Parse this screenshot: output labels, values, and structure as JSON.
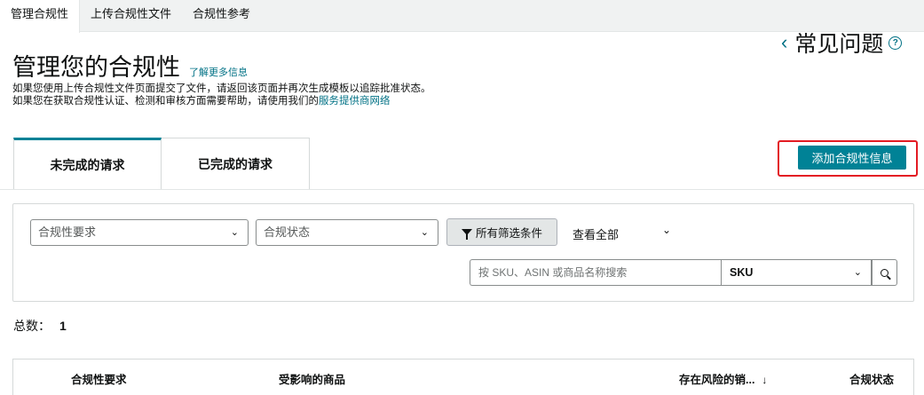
{
  "top_tabs": [
    "管理合规性",
    "上传合规性文件",
    "合规性参考"
  ],
  "header": {
    "title": "管理您的合规性",
    "learn_more": "了解更多信息",
    "desc_line1": "如果您使用上传合规性文件页面提交了文件，请返回该页面并再次生成模板以追踪批准状态。",
    "desc_line2_prefix": "如果您在获取合规性认证、检测和审核方面需要帮助，请使用我们的",
    "desc_line2_link": "服务提供商网络"
  },
  "faq": {
    "label": "常见问题",
    "help_glyph": "?"
  },
  "request_tabs": [
    "未完成的请求",
    "已完成的请求"
  ],
  "add_button_label": "添加合规性信息",
  "filters": {
    "requirement_placeholder": "合规性要求",
    "status_placeholder": "合规状态",
    "all_filters_label": "所有筛选条件",
    "view_all_label": "查看全部",
    "search_placeholder": "按 SKU、ASIN 或商品名称搜索",
    "search_type_value": "SKU"
  },
  "total": {
    "label": "总数：",
    "count": "1"
  },
  "table": {
    "columns": [
      "合规性要求",
      "受影响的商品",
      "存在风险的销...",
      "合规状态"
    ],
    "sort_glyph": "↓"
  },
  "colors": {
    "accent": "#008296",
    "link": "#007185",
    "highlight": "#e31b23"
  }
}
